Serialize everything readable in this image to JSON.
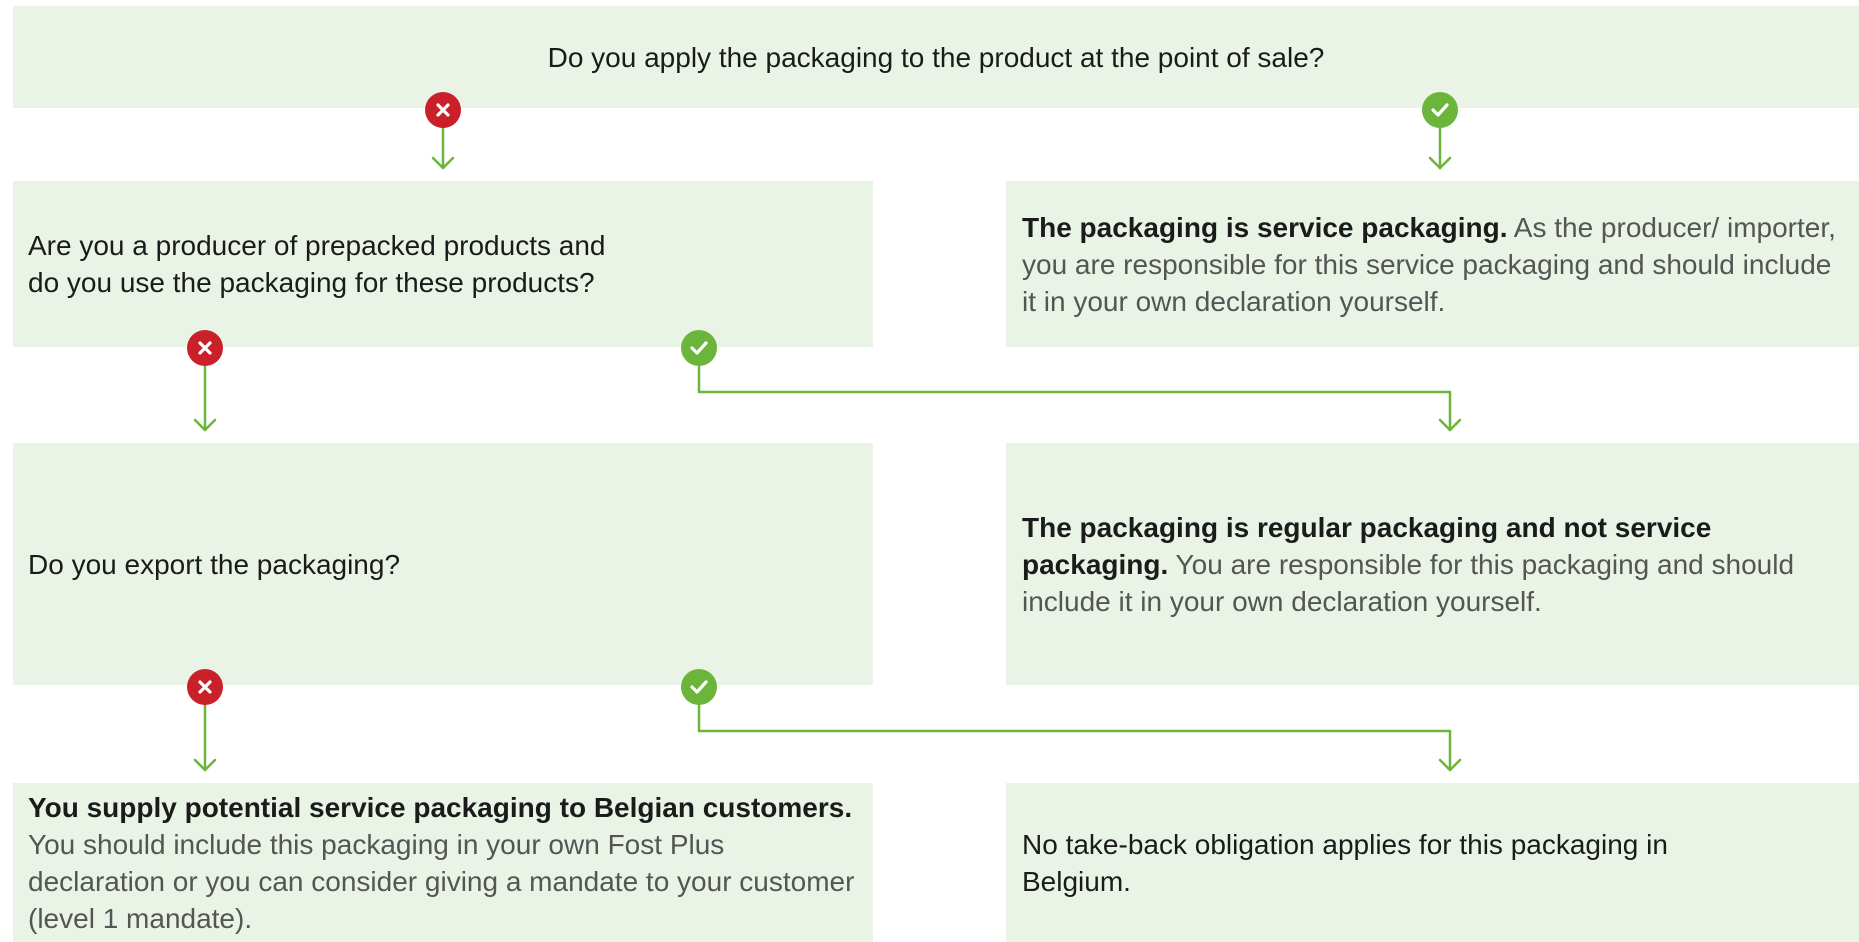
{
  "colors": {
    "box_fill": "#e9f4e6",
    "connector": "#6bb53a",
    "no_badge": "#c9202a",
    "yes_badge": "#6bb53a"
  },
  "icons": {
    "no": "cross-icon",
    "yes": "check-icon"
  },
  "question_1": "Do you apply the packaging to the product at the point of sale?",
  "question_2": "Are you a producer of prepacked products and do you use the packaging for these products?",
  "question_3": "Do you export the packaging?",
  "result_service": {
    "bold": "The packaging is service packaging.",
    "text": " As the producer/ importer, you are responsible for this service packaging and should include it in your own declaration yourself."
  },
  "result_regular": {
    "bold": "The packaging is regular packaging and not service packaging.",
    "text": " You are responsible for this packaging and should include it in your own declaration yourself."
  },
  "result_supply": {
    "bold": "You supply potential service packaging to Belgian customers.",
    "text": "You should include this packaging in your own Fost Plus declaration or you can consider giving a mandate to your customer (level 1 mandate)."
  },
  "result_no_takeback": {
    "bold": "No take-back obligation applies for this packaging in Belgium."
  }
}
